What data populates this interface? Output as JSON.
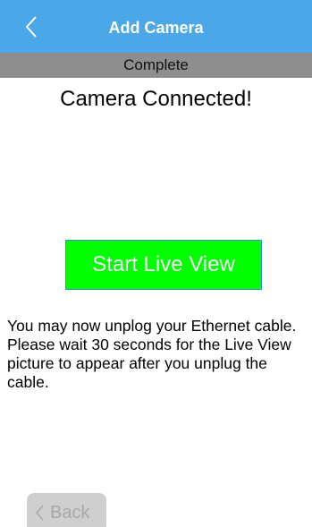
{
  "nav": {
    "title": "Add Camera",
    "back_icon": "chevron-left-icon"
  },
  "step": {
    "label": "Complete"
  },
  "status": {
    "title": "Camera Connected!"
  },
  "actions": {
    "start_live_view_label": "Start Live View"
  },
  "instructions": {
    "text": "You may now unplog your Ethernet cable. Please wait 30 seconds for the Live View picture to appear after you unplug the cable."
  },
  "footer": {
    "back_label": "Back",
    "back_icon": "chevron-left-icon"
  },
  "colors": {
    "nav_bar": "#4aa8e8",
    "step_bar": "#8e8e8e",
    "start_button": "#00ff00",
    "back_button": "#cfcfcf"
  }
}
